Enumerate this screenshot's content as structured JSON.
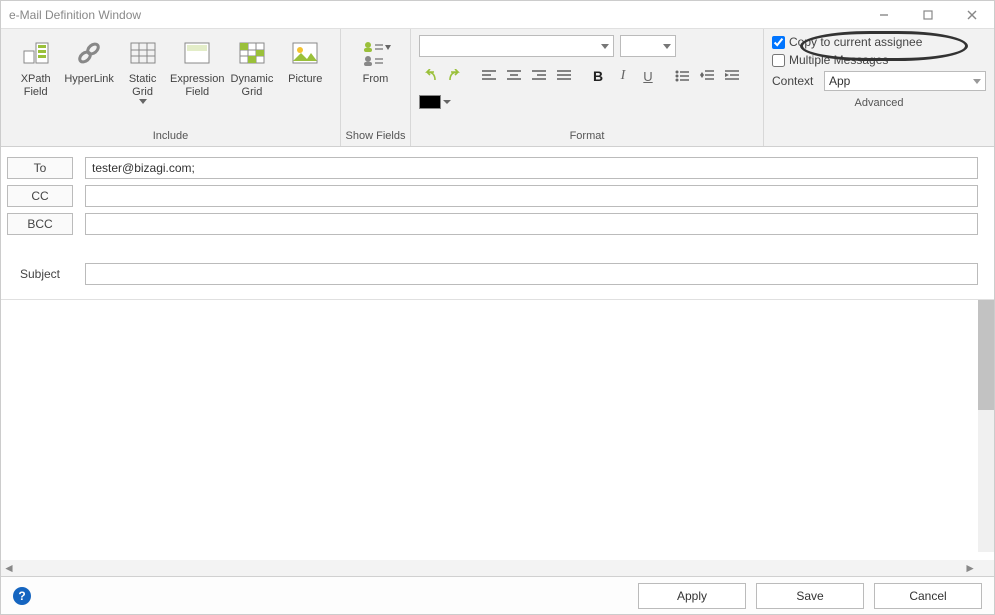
{
  "window": {
    "title": "e-Mail Definition Window"
  },
  "ribbon": {
    "include": {
      "groupLabel": "Include",
      "xpath": "XPath\nField",
      "hyperlink": "HyperLink",
      "staticgrid": "Static\nGrid",
      "exprfield": "Expression\nField",
      "dyngrid": "Dynamic\nGrid",
      "picture": "Picture"
    },
    "showfields": {
      "groupLabel": "Show Fields",
      "from": "From"
    },
    "format": {
      "groupLabel": "Format"
    },
    "advanced": {
      "groupLabel": "Advanced",
      "copyAssignee": {
        "label": "Copy to current assignee",
        "checked": true
      },
      "multiMessages": {
        "label": "Multiple Messages",
        "checked": false
      },
      "contextLabel": "Context",
      "contextValue": "App"
    }
  },
  "fields": {
    "toLabel": "To",
    "toValue": "tester@bizagi.com;",
    "ccLabel": "CC",
    "ccValue": "",
    "bccLabel": "BCC",
    "bccValue": "",
    "subjectLabel": "Subject",
    "subjectValue": ""
  },
  "footer": {
    "apply": "Apply",
    "save": "Save",
    "cancel": "Cancel"
  }
}
